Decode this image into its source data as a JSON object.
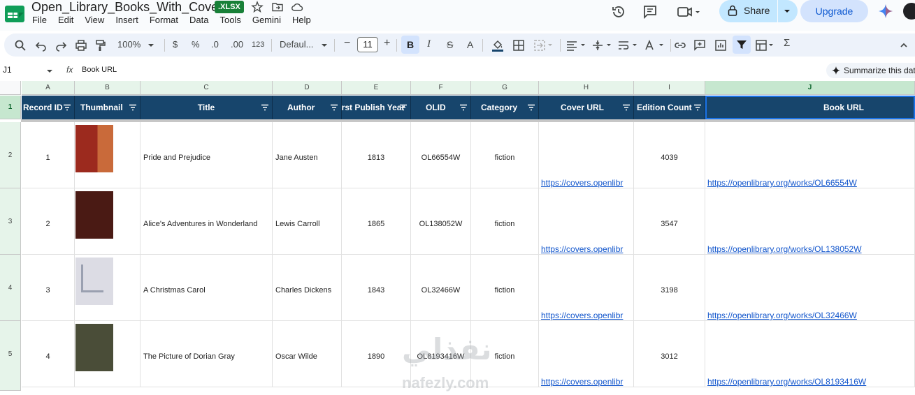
{
  "doc": {
    "title": "Open_Library_Books_With_Covers",
    "badge": ".XLSX"
  },
  "menu": [
    "File",
    "Edit",
    "View",
    "Insert",
    "Format",
    "Data",
    "Tools",
    "Gemini",
    "Help"
  ],
  "actions": {
    "share_label": "Share",
    "upgrade_label": "Upgrade"
  },
  "toolbar": {
    "zoom": "100%",
    "currency": "$",
    "percent": "%",
    "decrease_decimal": ".0",
    "increase_decimal": ".00",
    "number_format": "123",
    "font_name": "Defaul...",
    "font_size": "11",
    "minus": "−",
    "plus": "+",
    "bold": "B",
    "italic": "I",
    "strike": "S",
    "text_color": "A",
    "text_color_alt": "A",
    "sum": "Σ"
  },
  "formula_bar": {
    "cell_ref": "J1",
    "fx": "fx",
    "value": "Book URL",
    "summarize": "Summarize this dat"
  },
  "grid": {
    "columns": [
      "A",
      "B",
      "C",
      "D",
      "E",
      "F",
      "G",
      "H",
      "I",
      "J"
    ],
    "row_numbers": [
      "1",
      "2",
      "3",
      "4",
      "5"
    ],
    "headers": [
      "Record ID",
      "Thumbnail",
      "Title",
      "Author",
      "First Publish Year",
      "OLID",
      "Category",
      "Cover URL",
      "Edition Count",
      "Book URL"
    ],
    "rows": [
      {
        "id": "1",
        "title": "Pride and Prejudice",
        "author": "Jane Austen",
        "year": "1813",
        "olid": "OL66554W",
        "category": "fiction",
        "cover_url": "https://covers.openlibr",
        "editions": "4039",
        "book_url": "https://openlibrary.org/works/OL66554W",
        "thumb_color": "#9c2a1e"
      },
      {
        "id": "2",
        "title": "Alice's Adventures in Wonderland",
        "author": "Lewis Carroll",
        "year": "1865",
        "olid": "OL138052W",
        "category": "fiction",
        "cover_url": "https://covers.openlibr",
        "editions": "3547",
        "book_url": "https://openlibrary.org/works/OL138052W",
        "thumb_color": "#4a1a14"
      },
      {
        "id": "3",
        "title": "A Christmas Carol",
        "author": "Charles Dickens",
        "year": "1843",
        "olid": "OL32466W",
        "category": "fiction",
        "cover_url": "https://covers.openlibr",
        "editions": "3198",
        "book_url": "https://openlibrary.org/works/OL32466W",
        "thumb_color": "#dcdce4"
      },
      {
        "id": "4",
        "title": "The Picture of Dorian Gray",
        "author": "Oscar Wilde",
        "year": "1890",
        "olid": "OL8193416W",
        "category": "fiction",
        "cover_url": "https://covers.openlibr",
        "editions": "3012",
        "book_url": "https://openlibrary.org/works/OL8193416W",
        "thumb_color": "#4a4d38"
      }
    ]
  },
  "watermark": {
    "big": "نفذلي",
    "small": "nafezly.com"
  },
  "colors": {
    "header_fill": "#17456c",
    "link": "#1155cc",
    "share_bg": "#c2e7ff",
    "upgrade_bg": "#d3e3fd"
  }
}
